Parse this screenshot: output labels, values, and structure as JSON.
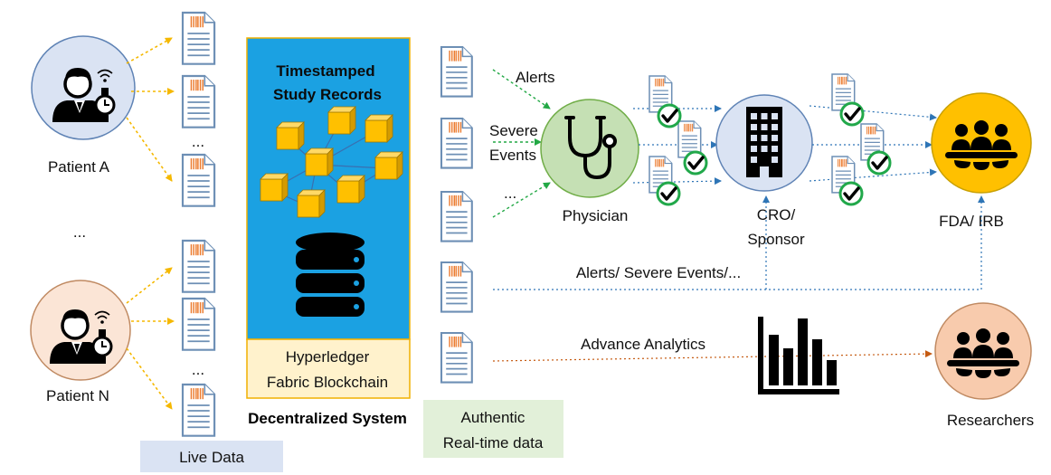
{
  "patients": [
    {
      "label": "Patient A",
      "circle_color": "#dae3f3"
    },
    {
      "label": "Patient N",
      "circle_color": "#fbe5d6"
    }
  ],
  "ellipsis": "...",
  "live_data_label": "Live Data",
  "blockchain": {
    "title_line1": "Timestamped",
    "title_line2": "Study Records",
    "footer_line1": "Hyperledger",
    "footer_line2": "Fabric Blockchain",
    "caption": "Decentralized System",
    "panel_color": "#1ba1e2",
    "footer_color": "#fff2cc",
    "cube_color": "#ffc000"
  },
  "authentic": {
    "line1": "Authentic",
    "line2": "Real-time data",
    "color": "#e2f0d9"
  },
  "event_labels": {
    "alerts": "Alerts",
    "severe_line1": "Severe",
    "severe_line2": "Events"
  },
  "nodes": {
    "physician": {
      "label": "Physician",
      "color": "#c5e0b4"
    },
    "cro": {
      "line1": "CRO/",
      "line2": "Sponsor",
      "color": "#dae3f3"
    },
    "fda": {
      "label": "FDA/ IRB",
      "color": "#ffc000"
    },
    "researchers": {
      "label": "Researchers",
      "color": "#f8cbad"
    }
  },
  "flows": {
    "alerts_severe": "Alerts/ Severe Events/...",
    "analytics": "Advance Analytics"
  },
  "colors": {
    "yellow_arrow": "#f5b800",
    "green_arrow": "#22a845",
    "blue_arrow": "#2e75b6",
    "orange_arrow": "#c55a11",
    "check_ring": "#21a84a"
  }
}
